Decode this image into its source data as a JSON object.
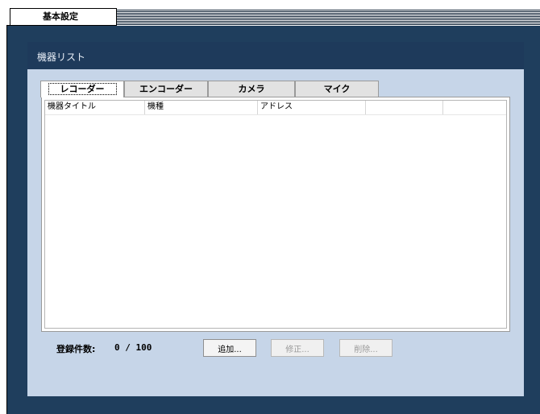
{
  "window": {
    "top_tab_label": "基本設定"
  },
  "panel": {
    "title": "機器リスト"
  },
  "tabs": [
    {
      "label": "レコーダー",
      "active": true
    },
    {
      "label": "エンコーダー",
      "active": false
    },
    {
      "label": "カメラ",
      "active": false
    },
    {
      "label": "マイク",
      "active": false
    }
  ],
  "table": {
    "columns": [
      "機器タイトル",
      "機種",
      "アドレス",
      ""
    ],
    "rows": []
  },
  "footer": {
    "count_label": "登録件数:",
    "count_value": "0 /  100",
    "add_label": "追加...",
    "edit_label": "修正...",
    "delete_label": "削除..."
  }
}
